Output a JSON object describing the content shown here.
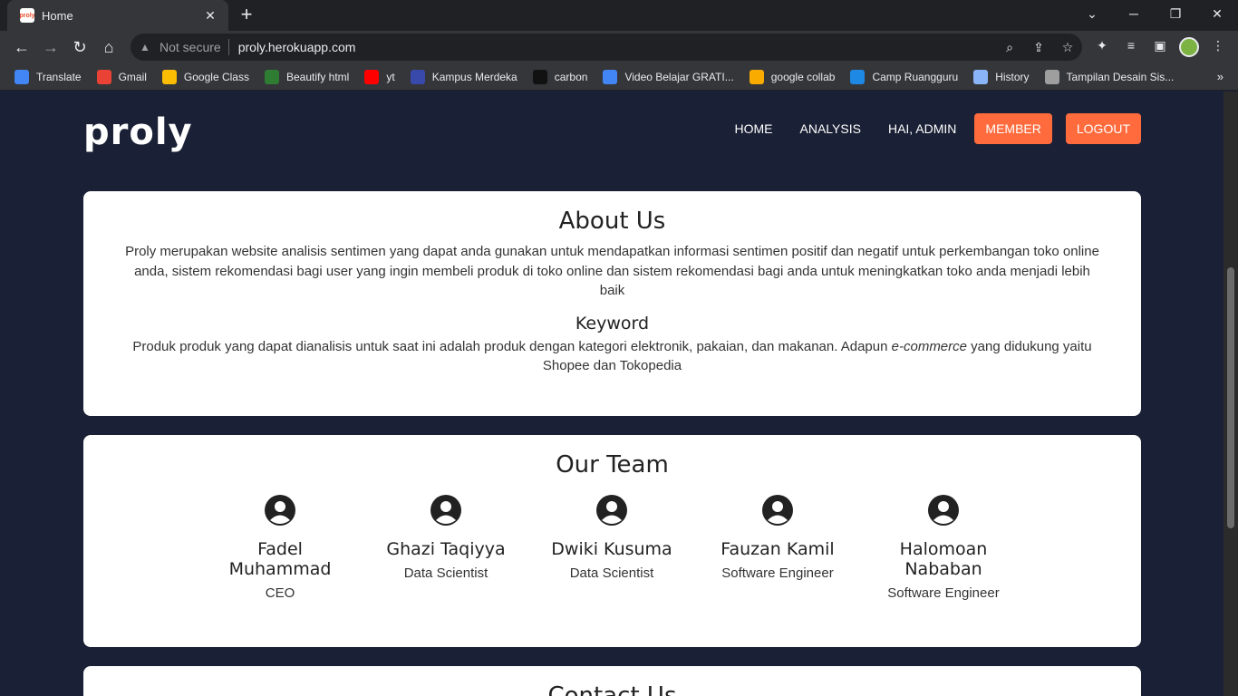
{
  "browser": {
    "tab_title": "Home",
    "tab_favicon_text": "proly",
    "address_status": "Not secure",
    "url": "proly.herokuapp.com",
    "bookmarks": [
      {
        "label": "Translate",
        "color": "#4285f4"
      },
      {
        "label": "Gmail",
        "color": "#ea4335"
      },
      {
        "label": "Google Class",
        "color": "#fbbc04"
      },
      {
        "label": "Beautify html",
        "color": "#2e7d32"
      },
      {
        "label": "yt",
        "color": "#ff0000"
      },
      {
        "label": "Kampus Merdeka",
        "color": "#3949ab"
      },
      {
        "label": "carbon",
        "color": "#111111"
      },
      {
        "label": "Video Belajar GRATI...",
        "color": "#4285f4"
      },
      {
        "label": "google collab",
        "color": "#f9ab00"
      },
      {
        "label": "Camp Ruangguru",
        "color": "#1e88e5"
      },
      {
        "label": "History",
        "color": "#8ab4f8"
      },
      {
        "label": "Tampilan Desain Sis...",
        "color": "#9e9e9e"
      }
    ]
  },
  "site": {
    "logo": "proly",
    "nav": {
      "home": "HOME",
      "analysis": "ANALYSIS",
      "greeting": "HAI, ADMIN",
      "member": "MEMBER",
      "logout": "LOGOUT"
    },
    "accent_color": "#ff6b3d",
    "background_color": "#1a2035"
  },
  "about": {
    "title": "About Us",
    "text": "Proly merupakan website analisis sentimen yang dapat anda gunakan untuk mendapatkan informasi sentimen positif dan negatif untuk perkembangan toko online anda, sistem rekomendasi bagi user yang ingin membeli produk di toko online dan sistem rekomendasi bagi anda untuk meningkatkan toko anda menjadi lebih baik",
    "keyword_title": "Keyword",
    "keyword_text_before": "Produk produk yang dapat dianalisis untuk saat ini adalah produk dengan kategori elektronik, pakaian, dan makanan. Adapun",
    "keyword_text_em": "e-commerce",
    "keyword_text_after": "yang didukung yaitu Shopee dan Tokopedia"
  },
  "team": {
    "title": "Our Team",
    "members": [
      {
        "name": "Fadel Muhammad",
        "role": "CEO"
      },
      {
        "name": "Ghazi Taqiyya",
        "role": "Data Scientist"
      },
      {
        "name": "Dwiki Kusuma",
        "role": "Data Scientist"
      },
      {
        "name": "Fauzan Kamil",
        "role": "Software Engineer"
      },
      {
        "name": "Halomoan Nababan",
        "role": "Software Engineer"
      }
    ]
  },
  "contact": {
    "title": "Contact Us"
  }
}
